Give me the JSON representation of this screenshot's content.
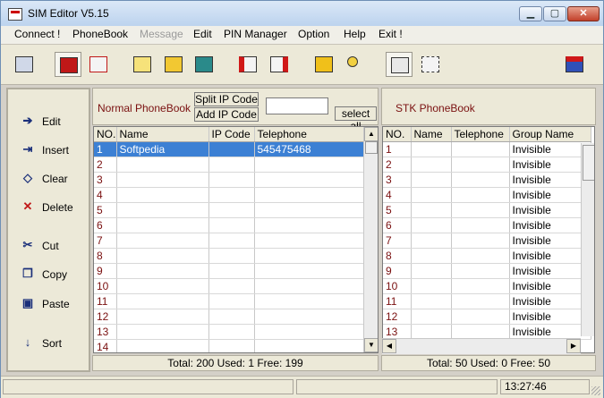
{
  "window": {
    "title": "SIM Editor V5.15"
  },
  "menu": [
    {
      "label": "Connect !",
      "enabled": true
    },
    {
      "label": "PhoneBook",
      "enabled": true
    },
    {
      "label": "Message",
      "enabled": false
    },
    {
      "label": "Edit",
      "enabled": true
    },
    {
      "label": "PIN Manager",
      "enabled": true
    },
    {
      "label": "Option",
      "enabled": true
    },
    {
      "label": "Help",
      "enabled": true
    },
    {
      "label": "Exit !",
      "enabled": true
    }
  ],
  "toolbar_icons": [
    "connect-icon",
    "sim-card-icon",
    "sms-icon",
    "message-icon",
    "open-folder-icon",
    "save-disk-icon",
    "import-icon",
    "export-icon",
    "lock-icon",
    "key-icon",
    "phonebook-transfer-icon",
    "sync-icon",
    "editor-logo-icon"
  ],
  "sidebar": [
    {
      "label": "Edit",
      "icon": "edit-icon"
    },
    {
      "label": "Insert",
      "icon": "insert-icon"
    },
    {
      "label": "Clear",
      "icon": "eraser-icon"
    },
    {
      "label": "Delete",
      "icon": "delete-x-icon"
    },
    {
      "label": "Cut",
      "icon": "scissors-icon"
    },
    {
      "label": "Copy",
      "icon": "copy-icon"
    },
    {
      "label": "Paste",
      "icon": "paste-icon"
    },
    {
      "label": "Sort",
      "icon": "sort-az-icon"
    }
  ],
  "normal": {
    "title": "Normal PhoneBook",
    "split_btn": "Split IP Code",
    "add_btn": "Add IP Code",
    "select_all_btn": "select all",
    "search_value": "",
    "columns": [
      "NO.",
      "Name",
      "IP Code",
      "Telephone"
    ],
    "rows": [
      [
        "1",
        "Softpedia",
        "",
        "545475468"
      ],
      [
        "2",
        "",
        "",
        ""
      ],
      [
        "3",
        "",
        "",
        ""
      ],
      [
        "4",
        "",
        "",
        ""
      ],
      [
        "5",
        "",
        "",
        ""
      ],
      [
        "6",
        "",
        "",
        ""
      ],
      [
        "7",
        "",
        "",
        ""
      ],
      [
        "8",
        "",
        "",
        ""
      ],
      [
        "9",
        "",
        "",
        ""
      ],
      [
        "10",
        "",
        "",
        ""
      ],
      [
        "11",
        "",
        "",
        ""
      ],
      [
        "12",
        "",
        "",
        ""
      ],
      [
        "13",
        "",
        "",
        ""
      ],
      [
        "14",
        "",
        "",
        ""
      ]
    ],
    "selected_row": 0,
    "totals": "Total: 200  Used: 1  Free: 199"
  },
  "stk": {
    "title": "STK PhoneBook",
    "columns": [
      "NO.",
      "Name",
      "Telephone",
      "Group Name"
    ],
    "rows": [
      [
        "1",
        "",
        "",
        "Invisible"
      ],
      [
        "2",
        "",
        "",
        "Invisible"
      ],
      [
        "3",
        "",
        "",
        "Invisible"
      ],
      [
        "4",
        "",
        "",
        "Invisible"
      ],
      [
        "5",
        "",
        "",
        "Invisible"
      ],
      [
        "6",
        "",
        "",
        "Invisible"
      ],
      [
        "7",
        "",
        "",
        "Invisible"
      ],
      [
        "8",
        "",
        "",
        "Invisible"
      ],
      [
        "9",
        "",
        "",
        "Invisible"
      ],
      [
        "10",
        "",
        "",
        "Invisible"
      ],
      [
        "11",
        "",
        "",
        "Invisible"
      ],
      [
        "12",
        "",
        "",
        "Invisible"
      ],
      [
        "13",
        "",
        "",
        "Invisible"
      ]
    ],
    "totals": "Total: 50  Used: 0  Free: 50"
  },
  "status": {
    "time": "13:27:46"
  },
  "colors": {
    "accent": "#3c80d4",
    "row_number": "#7a1010",
    "header_label": "#7a1010"
  }
}
